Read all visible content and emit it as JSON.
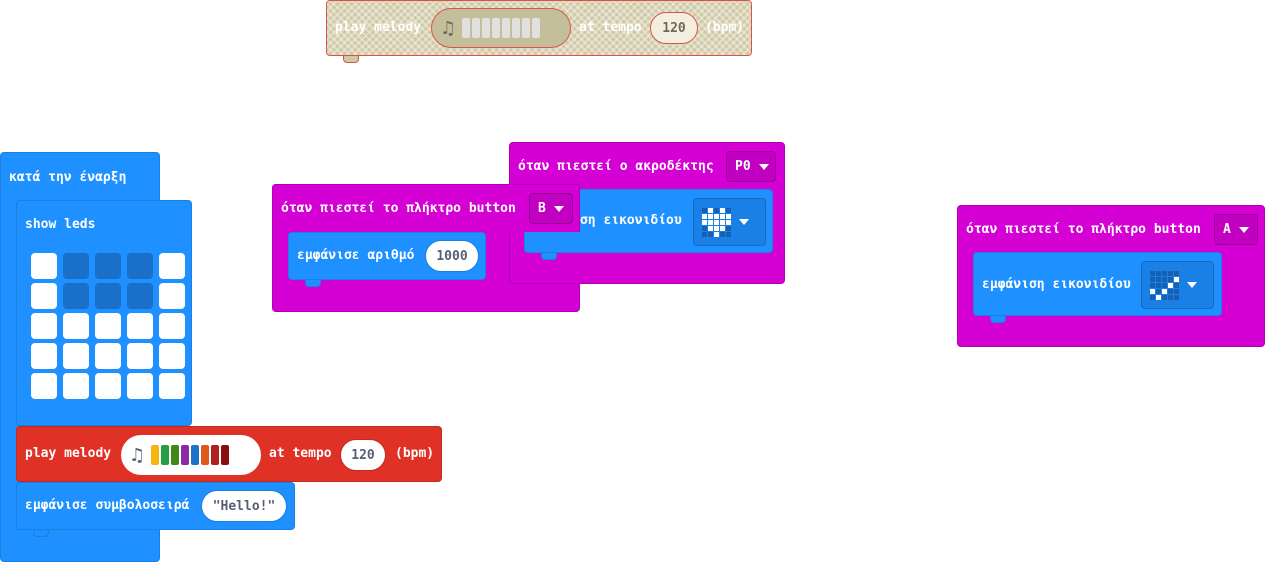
{
  "ghost_melody": {
    "play": "play melody",
    "at_tempo": "at tempo",
    "tempo": "120",
    "bpm": "(bpm)"
  },
  "on_start": {
    "title": "κατά την έναρξη",
    "show_leds": "show leds",
    "leds": [
      [
        1,
        0,
        0,
        0,
        1
      ],
      [
        1,
        0,
        0,
        0,
        1
      ],
      [
        1,
        1,
        1,
        1,
        1
      ],
      [
        1,
        1,
        1,
        1,
        1
      ],
      [
        1,
        1,
        1,
        1,
        1
      ]
    ],
    "melody": {
      "play": "play melody",
      "at_tempo": "at tempo",
      "tempo": "120",
      "bpm": "(bpm)",
      "note_colors": [
        "#f5b70f",
        "#24a043",
        "#3f8a17",
        "#8a2aa5",
        "#1b74c6",
        "#dd5a1b",
        "#b31e1e",
        "#8b0d0d"
      ]
    },
    "show_string": {
      "label": "εμφάνισε συμβολοσειρά",
      "value": "Hello!"
    }
  },
  "button_b": {
    "title": "όταν πιεστεί το πλήκτρο button",
    "button": "B",
    "show_number": {
      "label": "εμφάνισε αριθμό",
      "value": "1000"
    }
  },
  "pin_p0": {
    "title": "όταν πιεστεί ο ακροδέκτης",
    "pin": "P0",
    "show_icon": {
      "label": "εμφάνιση εικονιδίου",
      "icon": "heart-icon",
      "pattern": [
        [
          0,
          1,
          0,
          1,
          0
        ],
        [
          1,
          1,
          1,
          1,
          1
        ],
        [
          1,
          1,
          1,
          1,
          1
        ],
        [
          0,
          1,
          1,
          1,
          0
        ],
        [
          0,
          0,
          1,
          0,
          0
        ]
      ]
    }
  },
  "button_a": {
    "title": "όταν πιεστεί το πλήκτρο button",
    "button": "A",
    "show_icon": {
      "label": "εμφάνιση εικονιδίου",
      "icon": "check-icon",
      "pattern": [
        [
          0,
          0,
          0,
          0,
          0
        ],
        [
          0,
          0,
          0,
          0,
          1
        ],
        [
          0,
          0,
          0,
          1,
          0
        ],
        [
          1,
          0,
          1,
          0,
          0
        ],
        [
          0,
          1,
          0,
          0,
          0
        ]
      ]
    }
  },
  "colors": {
    "basic_blue": "#1e90ff",
    "input_magenta": "#d400d4",
    "music_red": "#e03127"
  }
}
